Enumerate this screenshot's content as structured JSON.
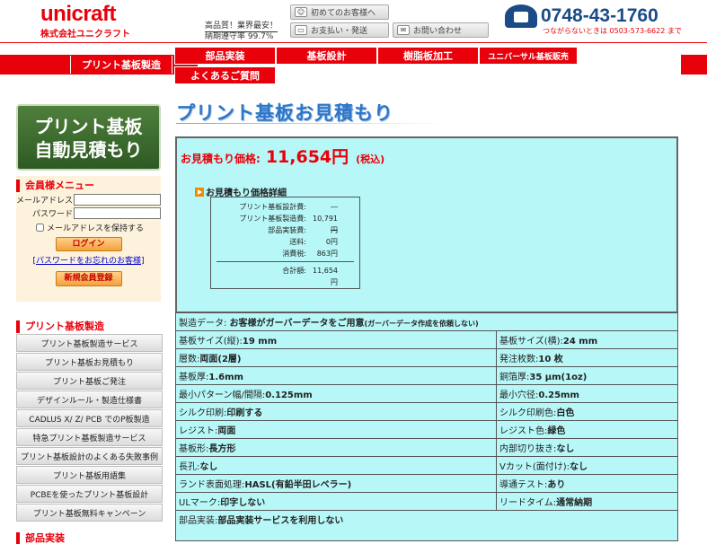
{
  "header": {
    "brand": "unicraft",
    "company": "株式会社ユニクラフト",
    "tagline1": "高品質！業界最安！",
    "tagline2": "納期遵守率 99.7%",
    "btn_first": "初めてのお客様へ",
    "btn_payment": "お支払い・発送",
    "btn_contact": "お問い合わせ",
    "phone": "0748-43-1760",
    "phone_note": "つながらないときは 0503-573-6622 まで"
  },
  "nav": {
    "section": "プリント基板製造",
    "items": [
      "部品実装",
      "基板設計",
      "樹脂板加工",
      "ユニバーサル基板販売",
      "よくあるご質問"
    ]
  },
  "sidebar": {
    "banner_line1": "プリント基板",
    "banner_line2": "自動見積もり",
    "member_title": "会員様メニュー",
    "email_label": "メールアドレス",
    "password_label": "パスワード",
    "keep_label": "メールアドレスを保持する",
    "login_label": "ログイン",
    "forgot_label": "パスワードをお忘れのお客様",
    "register_label": "新規会員登録",
    "pcb_title": "プリント基板製造",
    "menu": [
      "プリント基板製造サービス",
      "プリント基板お見積もり",
      "プリント基板ご発注",
      "デザインルール・製造仕様書",
      "CADLUS X/ Z/ PCB でのP板製造",
      "特急プリント基板製造サービス",
      "プリント基板設計のよくある失敗事例",
      "プリント基板用語集",
      "PCBEを使ったプリント基板設計",
      "プリント基板無料キャンペーン"
    ],
    "parts_title": "部品実装"
  },
  "main": {
    "title": "プリント基板お見積もり",
    "price_label": "お見積もり価格:",
    "price_value": "11,654円",
    "price_tax": "(税込)",
    "detail_title": "お見積もり価格詳細",
    "details": [
      {
        "k": "プリント基板設計費:",
        "v": "―"
      },
      {
        "k": "プリント基板製造費:",
        "v": "10,791円"
      },
      {
        "k": "部品実装費:",
        "v": "―"
      },
      {
        "k": "送料:",
        "v": "0円"
      },
      {
        "k": "消費税:",
        "v": "863円"
      }
    ],
    "total_label": "合計額:",
    "total_value": "11,654円",
    "data_row_label": "製造データ:",
    "data_row_value": "お客様がガーバーデータをご用意",
    "data_row_note": "(ガーバーデータ作成を依頼しない)",
    "specs": [
      [
        {
          "k": "基板サイズ(縦):",
          "v": "19 mm"
        },
        {
          "k": "基板サイズ(横):",
          "v": "24 mm"
        }
      ],
      [
        {
          "k": "層数:",
          "v": "両面(2層)"
        },
        {
          "k": "発注枚数:",
          "v": "10 枚"
        }
      ],
      [
        {
          "k": "基板厚:",
          "v": "1.6mm"
        },
        {
          "k": "銅箔厚:",
          "v": "35 μm(1oz)"
        }
      ],
      [
        {
          "k": "最小パターン幅/間隔:",
          "v": "0.125mm"
        },
        {
          "k": "最小穴径:",
          "v": "0.25mm"
        }
      ],
      [
        {
          "k": "シルク印刷:",
          "v": "印刷する"
        },
        {
          "k": "シルク印刷色:",
          "v": "白色"
        }
      ],
      [
        {
          "k": "レジスト:",
          "v": "両面"
        },
        {
          "k": "レジスト色:",
          "v": "緑色"
        }
      ],
      [
        {
          "k": "基板形:",
          "v": "長方形"
        },
        {
          "k": "内部切り抜き:",
          "v": "なし"
        }
      ],
      [
        {
          "k": "長孔:",
          "v": "なし"
        },
        {
          "k": "Vカット(面付け):",
          "v": "なし"
        }
      ],
      [
        {
          "k": "ランド表面処理:",
          "v": "HASL(有鉛半田レベラー)"
        },
        {
          "k": "導通テスト:",
          "v": "あり"
        }
      ],
      [
        {
          "k": "ULマーク:",
          "v": "印字しない"
        },
        {
          "k": "リードタイム:",
          "v": "通常納期"
        }
      ]
    ],
    "parts_label": "部品実装:",
    "parts_value": "部品実装サービスを利用しない"
  }
}
